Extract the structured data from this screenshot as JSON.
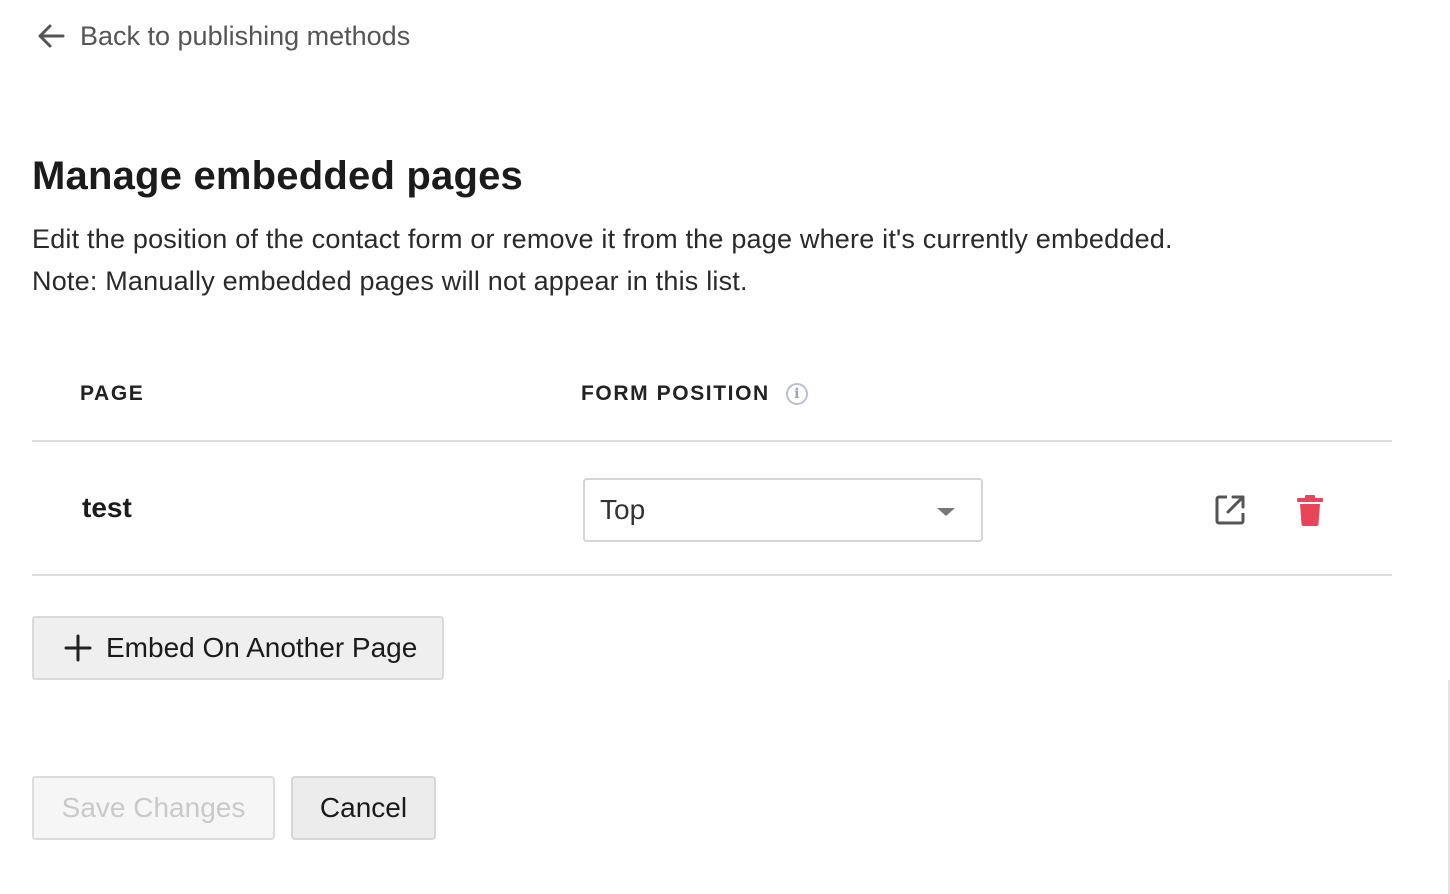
{
  "back_link": {
    "label": "Back to publishing methods",
    "icon": "arrow-left-icon"
  },
  "header": {
    "title": "Manage embedded pages",
    "description_line1": "Edit the position of the contact form or remove it from the page where it's currently embedded.",
    "description_line2": "Note: Manually embedded pages will not appear in this list."
  },
  "table": {
    "columns": {
      "page": "PAGE",
      "form_position": "FORM POSITION",
      "form_position_icon": "info-icon"
    },
    "rows": [
      {
        "page": "test",
        "form_position": "Top",
        "actions": [
          "open-external-icon",
          "trash-icon"
        ]
      }
    ]
  },
  "embed_button": {
    "label": "Embed On Another Page",
    "icon": "plus-icon"
  },
  "footer": {
    "save_label": "Save Changes",
    "save_disabled": true,
    "cancel_label": "Cancel"
  },
  "colors": {
    "delete": "#e8455a",
    "icon_gray": "#555555",
    "info_icon": "#b9bfd6",
    "disabled_text": "#c9c9c9"
  }
}
